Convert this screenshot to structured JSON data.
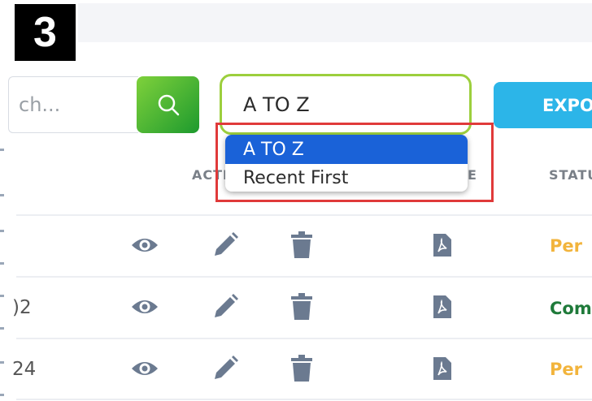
{
  "step_number": "3",
  "search": {
    "placeholder": "ch..."
  },
  "sort_select": {
    "value": "A TO Z",
    "options": [
      "A TO Z",
      "Recent First"
    ]
  },
  "export_button": {
    "label": "EXPO"
  },
  "columns": {
    "actions": "ACTI",
    "file": "E",
    "status": "STATU"
  },
  "rows": [
    {
      "id": "",
      "status": "Per",
      "status_color": "#f2b43c"
    },
    {
      "id": ")2",
      "status": "Com",
      "status_color": "#1f7a3a"
    },
    {
      "id": "24",
      "status": "Per",
      "status_color": "#f2b43c"
    }
  ],
  "colors": {
    "search_button": "#3cb043",
    "select_border": "#9ccf3d",
    "dropdown_selected": "#1a62d8",
    "highlight_box": "#e03a3a",
    "export_button": "#2cb5e8",
    "action_icons": "#6b7a90"
  },
  "icons": [
    "search-icon",
    "eye-icon",
    "pencil-icon",
    "trash-icon",
    "pdf-icon"
  ]
}
